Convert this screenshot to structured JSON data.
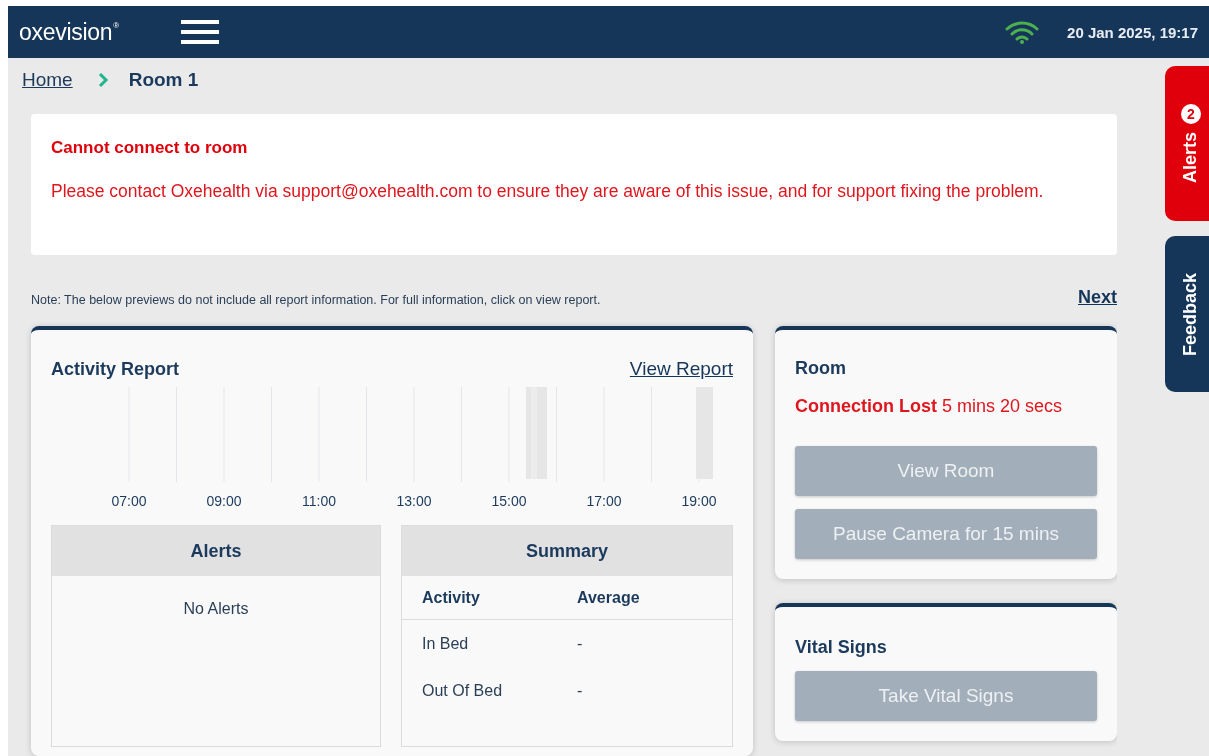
{
  "header": {
    "logo": "oxevision",
    "logo_mark": "®",
    "datetime": "20 Jan 2025, 19:17"
  },
  "breadcrumb": [
    {
      "label": "Home",
      "kind": "link"
    },
    {
      "label": "Room 1",
      "kind": "current"
    }
  ],
  "error_banner": {
    "title": "Cannot connect to room",
    "message": "Please contact Oxehealth via support@oxehealth.com to ensure they are aware of this issue, and for support fixing the problem."
  },
  "note": "Note: The below previews do not include all report information. For full information, click on view report.",
  "next_link": "Next",
  "activity_report": {
    "title": "Activity Report",
    "link": "View Report",
    "time_labels": [
      "07:00",
      "09:00",
      "11:00",
      "13:00",
      "15:00",
      "17:00",
      "19:00"
    ],
    "alerts": {
      "title": "Alerts",
      "empty": "No Alerts"
    },
    "summary": {
      "title": "Summary",
      "columns": [
        "Activity",
        "Average"
      ],
      "rows": [
        [
          "In Bed",
          "-"
        ],
        [
          "Out Of Bed",
          "-"
        ]
      ]
    }
  },
  "room": {
    "title": "Room",
    "status": "Connection Lost",
    "duration": "5 mins 20 secs",
    "buttons": [
      {
        "label": "View Room",
        "disabled": true
      },
      {
        "label": "Pause Camera for 15 mins",
        "disabled": true
      }
    ]
  },
  "vital_signs": {
    "title": "Vital Signs",
    "buttons": [
      {
        "label": "Take Vital Signs",
        "disabled": true
      }
    ]
  },
  "side_tabs": [
    {
      "label": "Alerts",
      "count": "2",
      "kind": "alert"
    },
    {
      "label": "Feedback",
      "kind": "plain"
    }
  ]
}
